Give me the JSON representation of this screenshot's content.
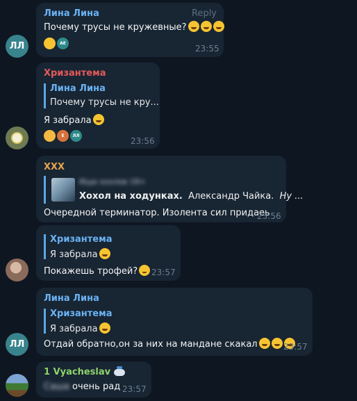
{
  "messages": [
    {
      "sender": "Лина Лина",
      "sender_color": "#6ab3f3",
      "text": "Почему трусы не кружевные?",
      "emoji_count": 3,
      "reply_label": "Reply",
      "time": "23:55",
      "avatar_initials": "ЛЛ",
      "reaction_avatar": "AE"
    },
    {
      "sender": "Хризантема",
      "sender_color": "#e35a5a",
      "quote_name": "Лина Лина",
      "quote_text": "Почему трусы не кру...",
      "text": "Я забрала",
      "time": "23:56",
      "reaction_avatars": [
        "E",
        "ЛЛ"
      ]
    },
    {
      "sender": "XXX",
      "sender_color": "#e8a24d",
      "link_source": "Ищи хохлов 18+",
      "link_title": "Хохол на ходунках.",
      "link_author": "Александр Чайка.",
      "link_more": "Ну ...",
      "text": "Очередной терминатор. Изолента сил придаеь",
      "time": "23:56"
    },
    {
      "quote_name": "Хризантема",
      "quote_text": "Я забрала",
      "text": "Покажешь трофей?",
      "time": "23:57"
    },
    {
      "sender": "Лина Лина",
      "sender_color": "#6ab3f3",
      "quote_name": "Хризантема",
      "quote_text": "Я забрала",
      "text": "Отдай обратно,он за них на мандане скакал",
      "time": "23:57",
      "avatar_initials": "ЛЛ"
    },
    {
      "sender": "1 Vyacheslav",
      "sender_color": "#8fd46b",
      "hidden_word": "Саша",
      "text": "очень рад",
      "time": "23:57"
    }
  ]
}
